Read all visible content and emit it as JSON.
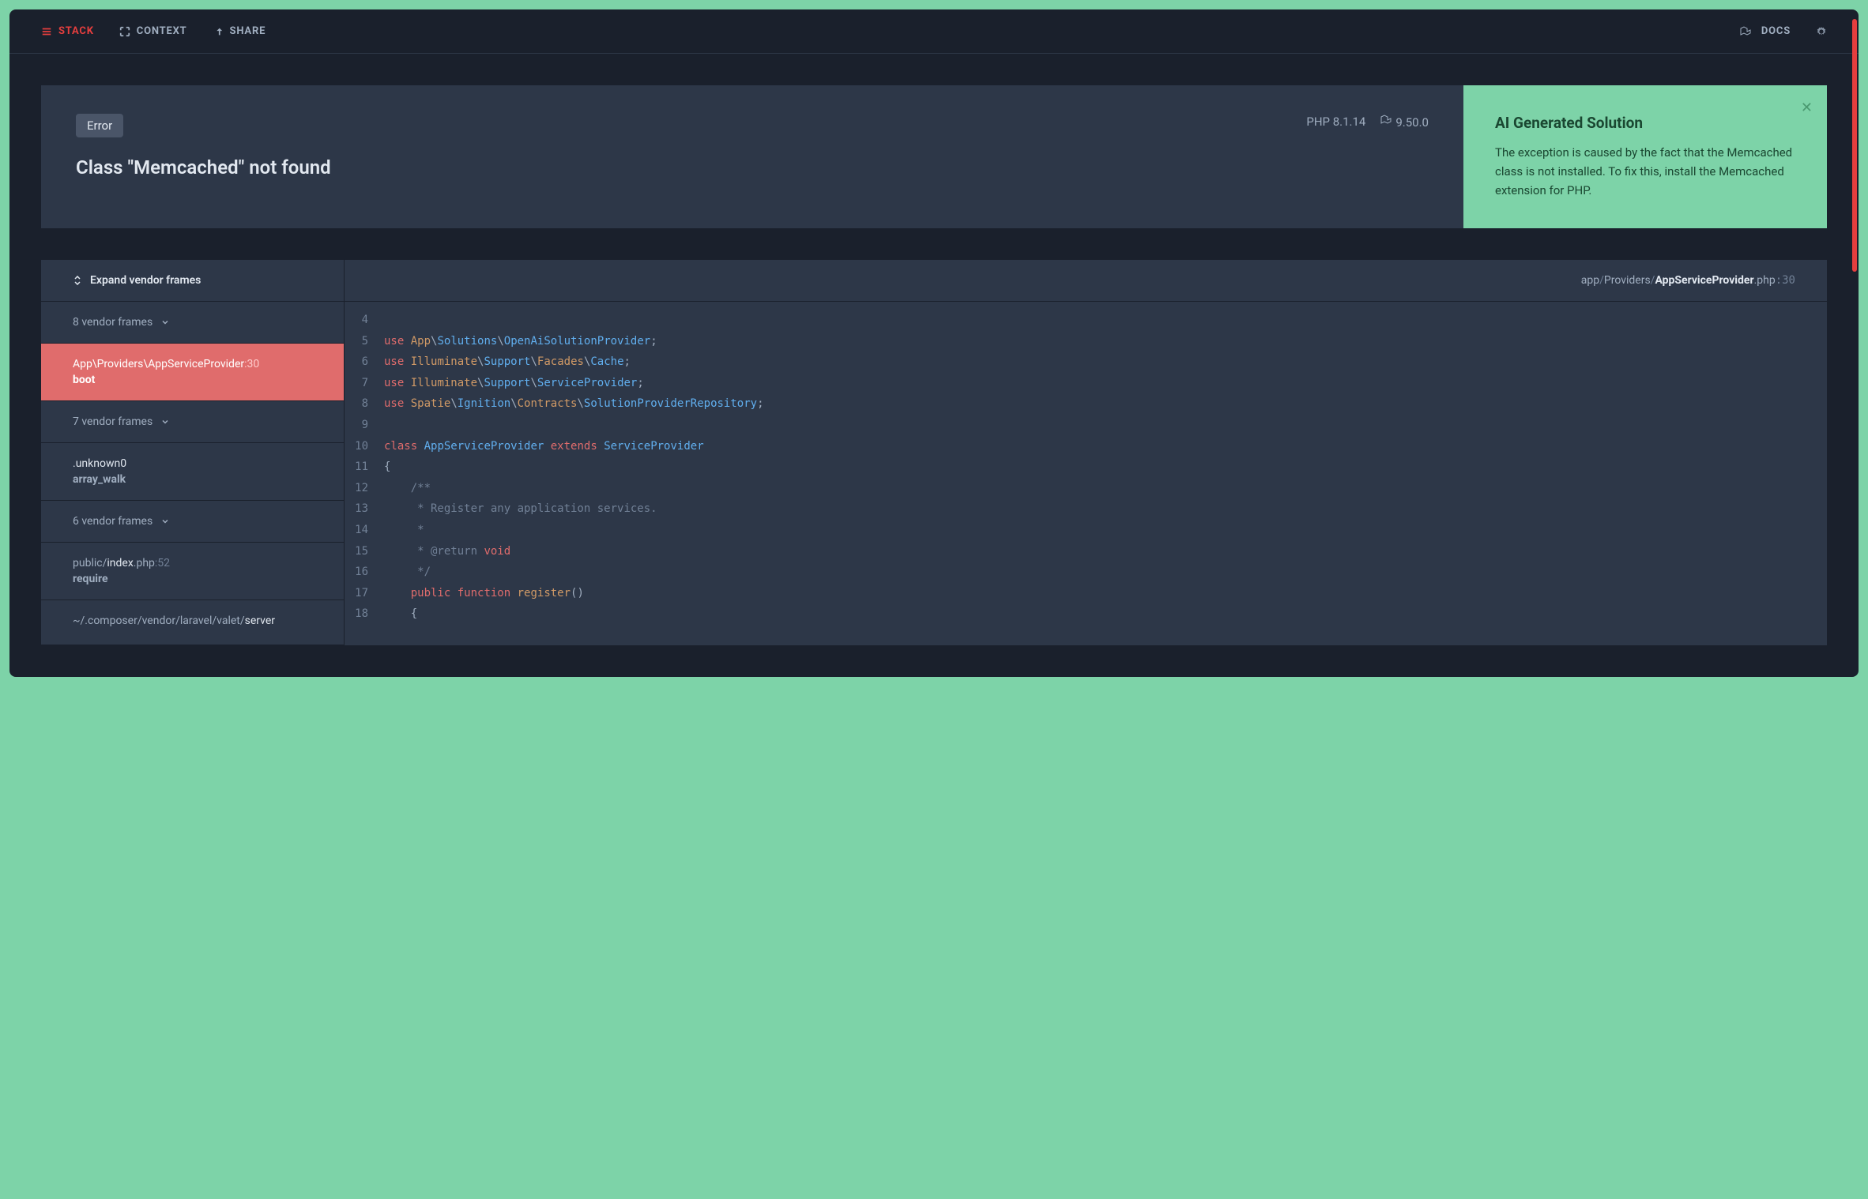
{
  "nav": {
    "stack": "STACK",
    "context": "CONTEXT",
    "share": "SHARE",
    "docs": "DOCS"
  },
  "error": {
    "badge": "Error",
    "php_version": "PHP 8.1.14",
    "framework_version": "9.50.0",
    "title": "Class \"Memcached\" not found"
  },
  "solution": {
    "title": "AI Generated Solution",
    "text": "The exception is caused by the fact that the Memcached class is not installed. To fix this, install the Memcached extension for PHP."
  },
  "sidebar": {
    "expand_label": "Expand vendor frames",
    "frames": [
      {
        "type": "vendor",
        "label": "8 vendor frames"
      },
      {
        "type": "frame",
        "active": true,
        "path_pre": "App\\Providers\\",
        "path_main": "AppServiceProvider",
        "line": ":30",
        "method": "boot"
      },
      {
        "type": "vendor",
        "label": "7 vendor frames"
      },
      {
        "type": "frame",
        "path_pre": "",
        "path_main": ".unknown0",
        "line": "",
        "method": "array_walk"
      },
      {
        "type": "vendor",
        "label": "6 vendor frames"
      },
      {
        "type": "frame",
        "path_pre": "public/",
        "path_main": "index",
        "path_post": ".php",
        "line": ":52",
        "method": "require"
      },
      {
        "type": "frame",
        "path_pre": "~/.composer/vendor/laravel/valet/",
        "path_main": "server",
        "line": "",
        "method": ""
      }
    ]
  },
  "file": {
    "path_parts": [
      "app",
      "Providers"
    ],
    "filename": "AppServiceProvider",
    "ext": ".php",
    "line": ":30"
  },
  "code": {
    "lines": [
      {
        "n": 4,
        "html": ""
      },
      {
        "n": 5,
        "html": "<span class=\"kw-use\">use</span> <span class=\"ns1\">App</span><span class=\"punc\">\\</span><span class=\"ns2\">Solutions</span><span class=\"punc\">\\</span><span class=\"cls\">OpenAiSolutionProvider</span><span class=\"punc\">;</span>"
      },
      {
        "n": 6,
        "html": "<span class=\"kw-use\">use</span> <span class=\"ns1\">Illuminate</span><span class=\"punc\">\\</span><span class=\"ns2\">Support</span><span class=\"punc\">\\</span><span class=\"ns1\">Facades</span><span class=\"punc\">\\</span><span class=\"cls\">Cache</span><span class=\"punc\">;</span>"
      },
      {
        "n": 7,
        "html": "<span class=\"kw-use\">use</span> <span class=\"ns1\">Illuminate</span><span class=\"punc\">\\</span><span class=\"ns2\">Support</span><span class=\"punc\">\\</span><span class=\"cls\">ServiceProvider</span><span class=\"punc\">;</span>"
      },
      {
        "n": 8,
        "html": "<span class=\"kw-use\">use</span> <span class=\"ns1\">Spatie</span><span class=\"punc\">\\</span><span class=\"ns2\">Ignition</span><span class=\"punc\">\\</span><span class=\"ns1\">Contracts</span><span class=\"punc\">\\</span><span class=\"cls\">SolutionProviderRepository</span><span class=\"punc\">;</span>"
      },
      {
        "n": 9,
        "html": ""
      },
      {
        "n": 10,
        "html": "<span class=\"kw-class\">class</span> <span class=\"cls\">AppServiceProvider</span> <span class=\"kw-extends\">extends</span> <span class=\"cls\">ServiceProvider</span>"
      },
      {
        "n": 11,
        "html": "<span class=\"brace\">{</span>"
      },
      {
        "n": 12,
        "html": "    <span class=\"comment\">/**</span>"
      },
      {
        "n": 13,
        "html": "    <span class=\"comment\"> * Register any application services.</span>"
      },
      {
        "n": 14,
        "html": "    <span class=\"comment\"> *</span>"
      },
      {
        "n": 15,
        "html": "    <span class=\"comment\"> * @return</span> <span class=\"kw-void\">void</span>"
      },
      {
        "n": 16,
        "html": "    <span class=\"comment\"> */</span>"
      },
      {
        "n": 17,
        "html": "    <span class=\"kw-public\">public</span> <span class=\"kw-function\">function</span> <span class=\"fn-name\">register</span><span class=\"punc\">()</span>"
      },
      {
        "n": 18,
        "html": "    <span class=\"brace\">{</span>"
      }
    ]
  }
}
